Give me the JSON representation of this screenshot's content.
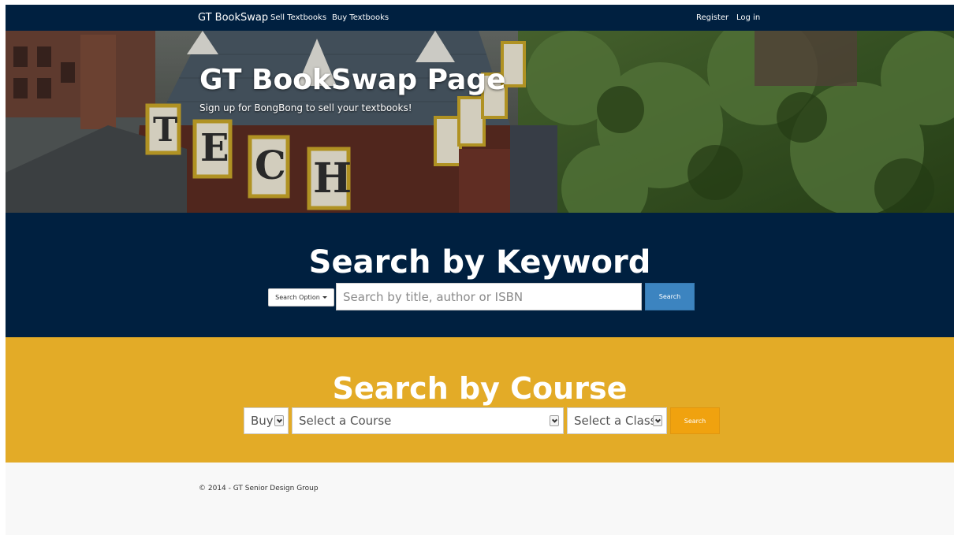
{
  "navbar": {
    "brand": "GT BookSwap",
    "links": [
      "Sell Textbooks",
      "Buy Textbooks"
    ],
    "right_links": [
      "Register",
      "Log in"
    ]
  },
  "hero": {
    "title": "GT BookSwap Page",
    "subtitle": "Sign up for BongBong to sell your textbooks!"
  },
  "keyword_search": {
    "heading": "Search by Keyword",
    "option_button": "Search Option",
    "input_placeholder": "Search by title, author or ISBN",
    "search_button": "Search"
  },
  "course_search": {
    "heading": "Search by Course",
    "mode_select": "Buy",
    "course_select": "Select a Course",
    "class_select": "Select a Class",
    "search_button": "Search"
  },
  "footer": {
    "copyright": "© 2014 - GT Senior Design Group"
  },
  "colors": {
    "navy": "#002040",
    "gold": "#e3ab27",
    "search_blue": "#3c84c0",
    "search_orange": "#f0a20f",
    "footer_bg": "#f8f8f8"
  }
}
